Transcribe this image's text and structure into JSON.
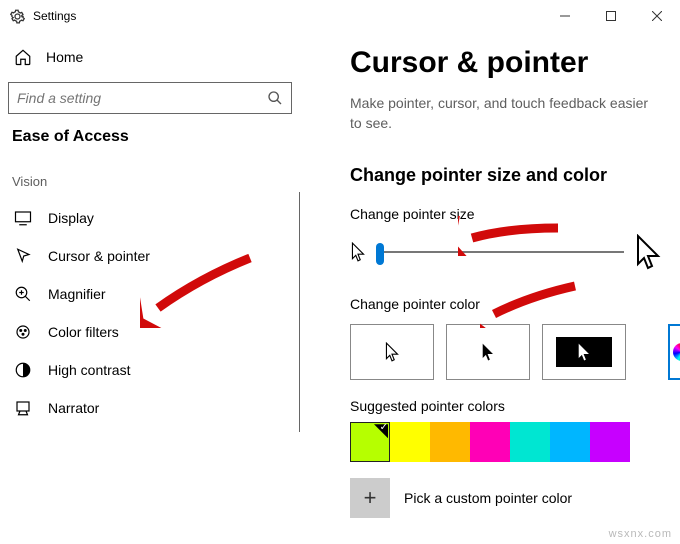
{
  "window": {
    "title": "Settings"
  },
  "sidebar": {
    "home": "Home",
    "search_placeholder": "Find a setting",
    "section": "Ease of Access",
    "group": "Vision",
    "items": [
      {
        "label": "Display"
      },
      {
        "label": "Cursor & pointer"
      },
      {
        "label": "Magnifier"
      },
      {
        "label": "Color filters"
      },
      {
        "label": "High contrast"
      },
      {
        "label": "Narrator"
      }
    ]
  },
  "page": {
    "title": "Cursor & pointer",
    "description": "Make pointer, cursor, and touch feedback easier to see.",
    "section_title": "Change pointer size and color",
    "size_label": "Change pointer size",
    "color_label": "Change pointer color",
    "suggested_label": "Suggested pointer colors",
    "custom_label": "Pick a custom pointer color"
  },
  "swatches": [
    {
      "color": "#b6ff00",
      "selected": true
    },
    {
      "color": "#ffff00",
      "selected": false
    },
    {
      "color": "#ffb900",
      "selected": false
    },
    {
      "color": "#ff00b6",
      "selected": false
    },
    {
      "color": "#00e6d2",
      "selected": false
    },
    {
      "color": "#00b6ff",
      "selected": false
    },
    {
      "color": "#c700ff",
      "selected": false
    }
  ],
  "watermark": "wsxnx.com"
}
